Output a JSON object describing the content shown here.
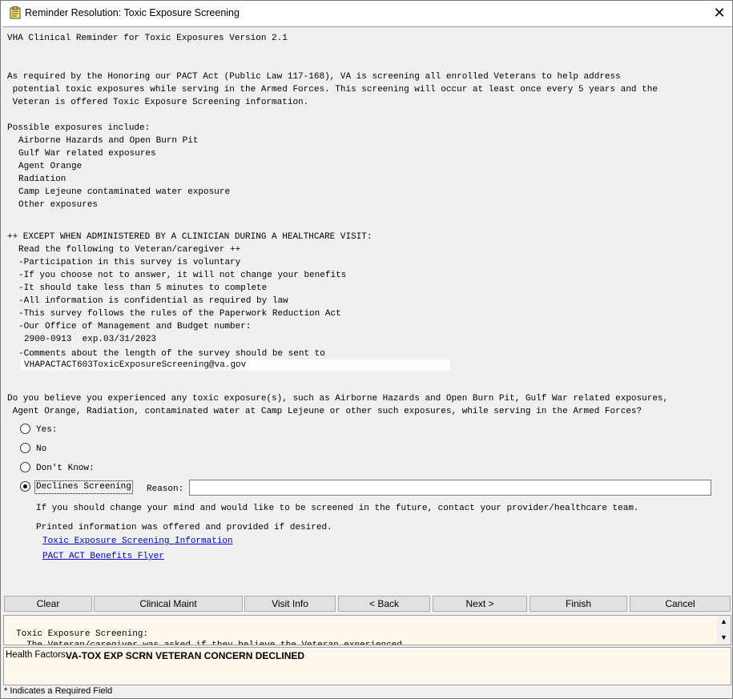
{
  "window": {
    "title": "Reminder Resolution: Toxic Exposure Screening"
  },
  "dialog": {
    "header_line": "VHA Clinical Reminder for Toxic Exposures Version 2.1",
    "intro": [
      "As required by the Honoring our PACT Act (Public Law 117-168), VA is screening all enrolled Veterans to help address",
      " potential toxic exposures while serving in the Armed Forces. This screening will occur at least once every 5 years and the",
      " Veteran is offered Toxic Exposure Screening information."
    ],
    "exposures_heading": "Possible exposures include:",
    "exposures": [
      "Airborne Hazards and Open Burn Pit",
      "Gulf War related exposures",
      "Agent Orange",
      "Radiation",
      "Camp Lejeune contaminated water exposure",
      "Other exposures"
    ],
    "except_heading": "++ EXCEPT WHEN ADMINISTERED BY A CLINICIAN DURING A HEALTHCARE VISIT:",
    "read_following": "Read the following to Veteran/caregiver ++",
    "notices": [
      "-Participation in this survey is voluntary",
      "-If you choose not to answer, it will not change your benefits",
      "-It should take less than 5 minutes to complete",
      "-All information is confidential as required by law",
      "-This survey follows the rules of the Paperwork Reduction Act",
      "-Our Office of Management and Budget number:"
    ],
    "omb_number": "2900-0913  exp.03/31/2023",
    "comments_line": "-Comments about the length of the survey should be sent to",
    "email": "VHAPACTACT603ToxicExposureScreening@va.gov",
    "question": [
      "Do you believe you experienced any toxic exposure(s), such as Airborne Hazards and Open Burn Pit, Gulf War related exposures,",
      " Agent Orange, Radiation, contaminated water at Camp Lejeune or other such exposures, while serving in the Armed Forces?"
    ],
    "options": {
      "yes": "Yes:",
      "no": "No",
      "dont_know": "Don't Know:",
      "declines": "Declines Screening"
    },
    "reason_label": "Reason:",
    "reason_value": "",
    "change_mind": "If you should change your mind and would like to be screened in the future, contact your provider/healthcare team.",
    "printed_info": "Printed information was offered and provided if desired.",
    "links": {
      "tox_info": "Toxic Exposure Screening Information",
      "pact_flyer": "PACT ACT Benefits Flyer"
    }
  },
  "buttons": {
    "clear": "Clear",
    "clinical_maint": "Clinical Maint",
    "visit_info": "Visit Info",
    "back": "< Back",
    "next": "Next >",
    "finish": "Finish",
    "cancel": "Cancel"
  },
  "preview": {
    "line1": "Toxic Exposure Screening:",
    "line2": "  The Veteran/caregiver was asked if they believe the Veteran experienced"
  },
  "health_factors": {
    "label": "Health Factors:",
    "value": "VA-TOX EXP SCRN VETERAN CONCERN DECLINED"
  },
  "status": {
    "required_note": "* Indicates a Required Field"
  },
  "colors": {
    "link": "#0000cc",
    "preview_bg": "#fdf8ec",
    "window_bg": "#f0f0f0"
  }
}
